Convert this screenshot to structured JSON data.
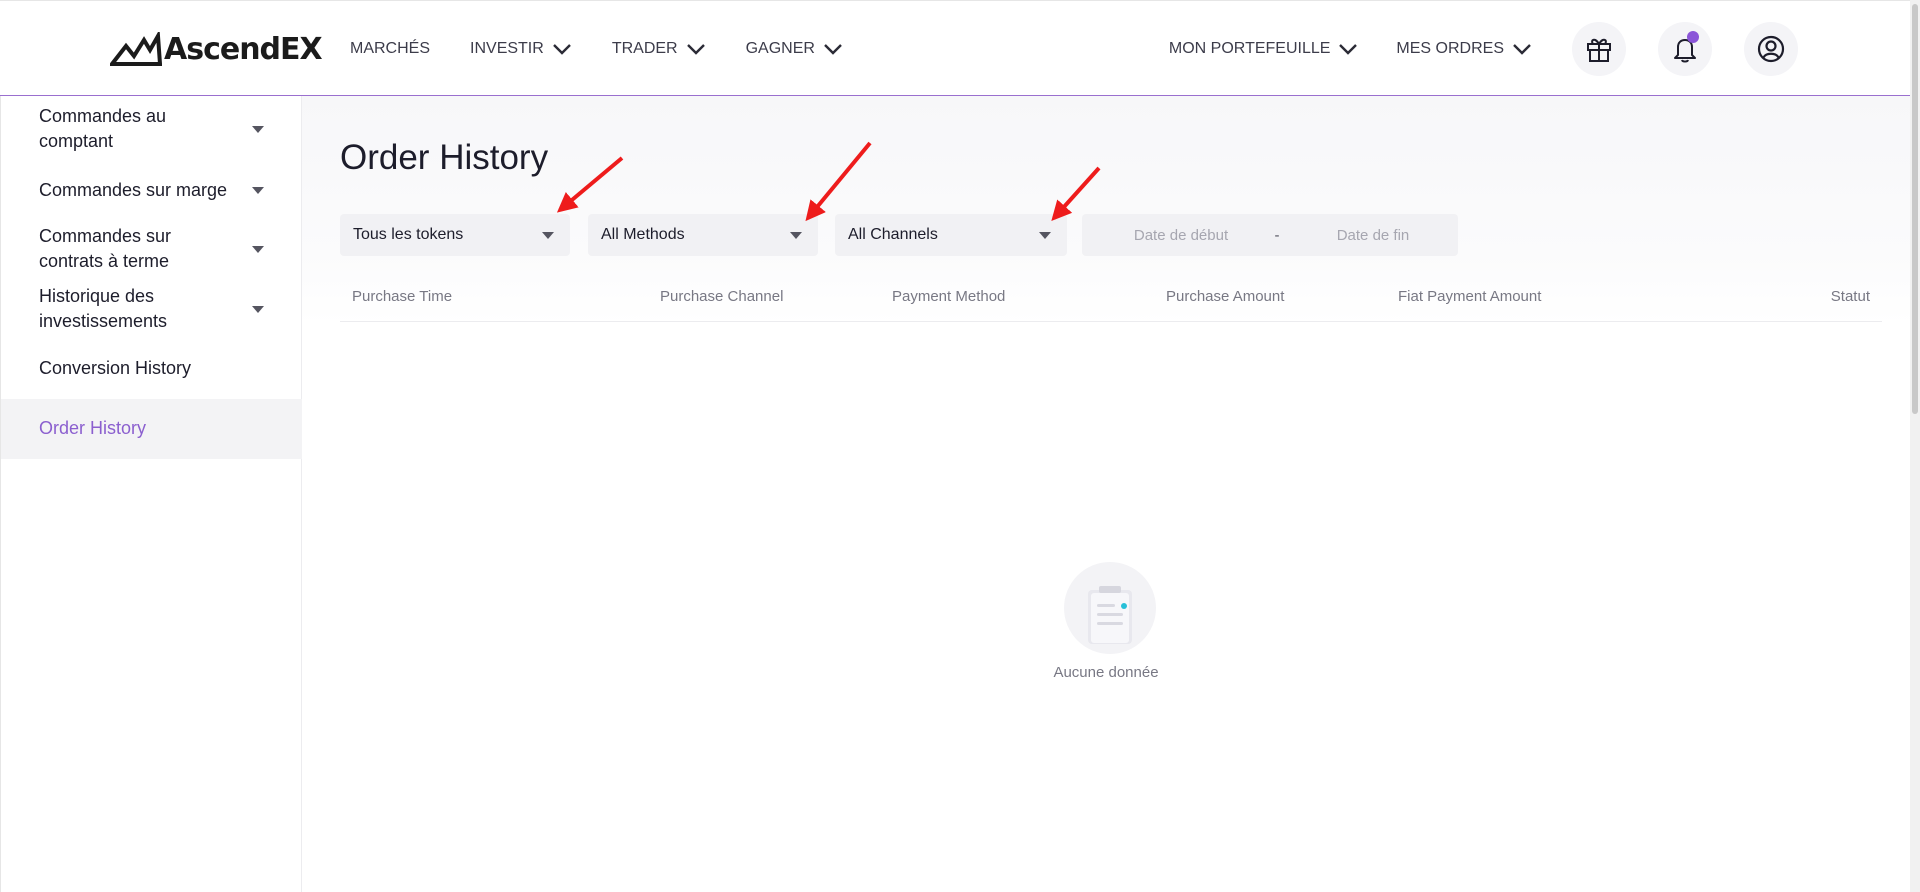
{
  "app": {
    "brand": "AscendEX"
  },
  "nav": {
    "left": [
      {
        "label": "MARCHÉS",
        "has_dropdown": false
      },
      {
        "label": "INVESTIR",
        "has_dropdown": true
      },
      {
        "label": "TRADER",
        "has_dropdown": true
      },
      {
        "label": "GAGNER",
        "has_dropdown": true
      }
    ],
    "right": [
      {
        "label": "MON PORTEFEUILLE",
        "has_dropdown": true
      },
      {
        "label": "MES ORDRES",
        "has_dropdown": true
      }
    ],
    "icons": [
      "gift-icon",
      "bell-icon",
      "user-account-icon"
    ],
    "notification_dot": true
  },
  "sidebar": {
    "items": [
      {
        "label": "Commandes au comptant",
        "has_dropdown": true,
        "active": false
      },
      {
        "label": "Commandes sur marge",
        "has_dropdown": true,
        "active": false
      },
      {
        "label": "Commandes sur contrats à terme",
        "has_dropdown": true,
        "active": false
      },
      {
        "label": "Historique des investissements",
        "has_dropdown": true,
        "active": false
      },
      {
        "label": "Conversion History",
        "has_dropdown": false,
        "active": false
      },
      {
        "label": "Order History",
        "has_dropdown": false,
        "active": true
      }
    ]
  },
  "main": {
    "title": "Order History",
    "filters": {
      "token": "Tous les tokens",
      "method": "All Methods",
      "channel": "All Channels",
      "start_date_placeholder": "Date de début",
      "date_separator": "-",
      "end_date_placeholder": "Date de fin"
    },
    "table": {
      "columns": [
        "Purchase Time",
        "Purchase Channel",
        "Payment Method",
        "Purchase Amount",
        "Fiat Payment Amount",
        "Statut"
      ]
    },
    "empty_text": "Aucune donnée"
  },
  "colors": {
    "accent": "#8b5fcf",
    "annotation": "#ee1c1c"
  }
}
